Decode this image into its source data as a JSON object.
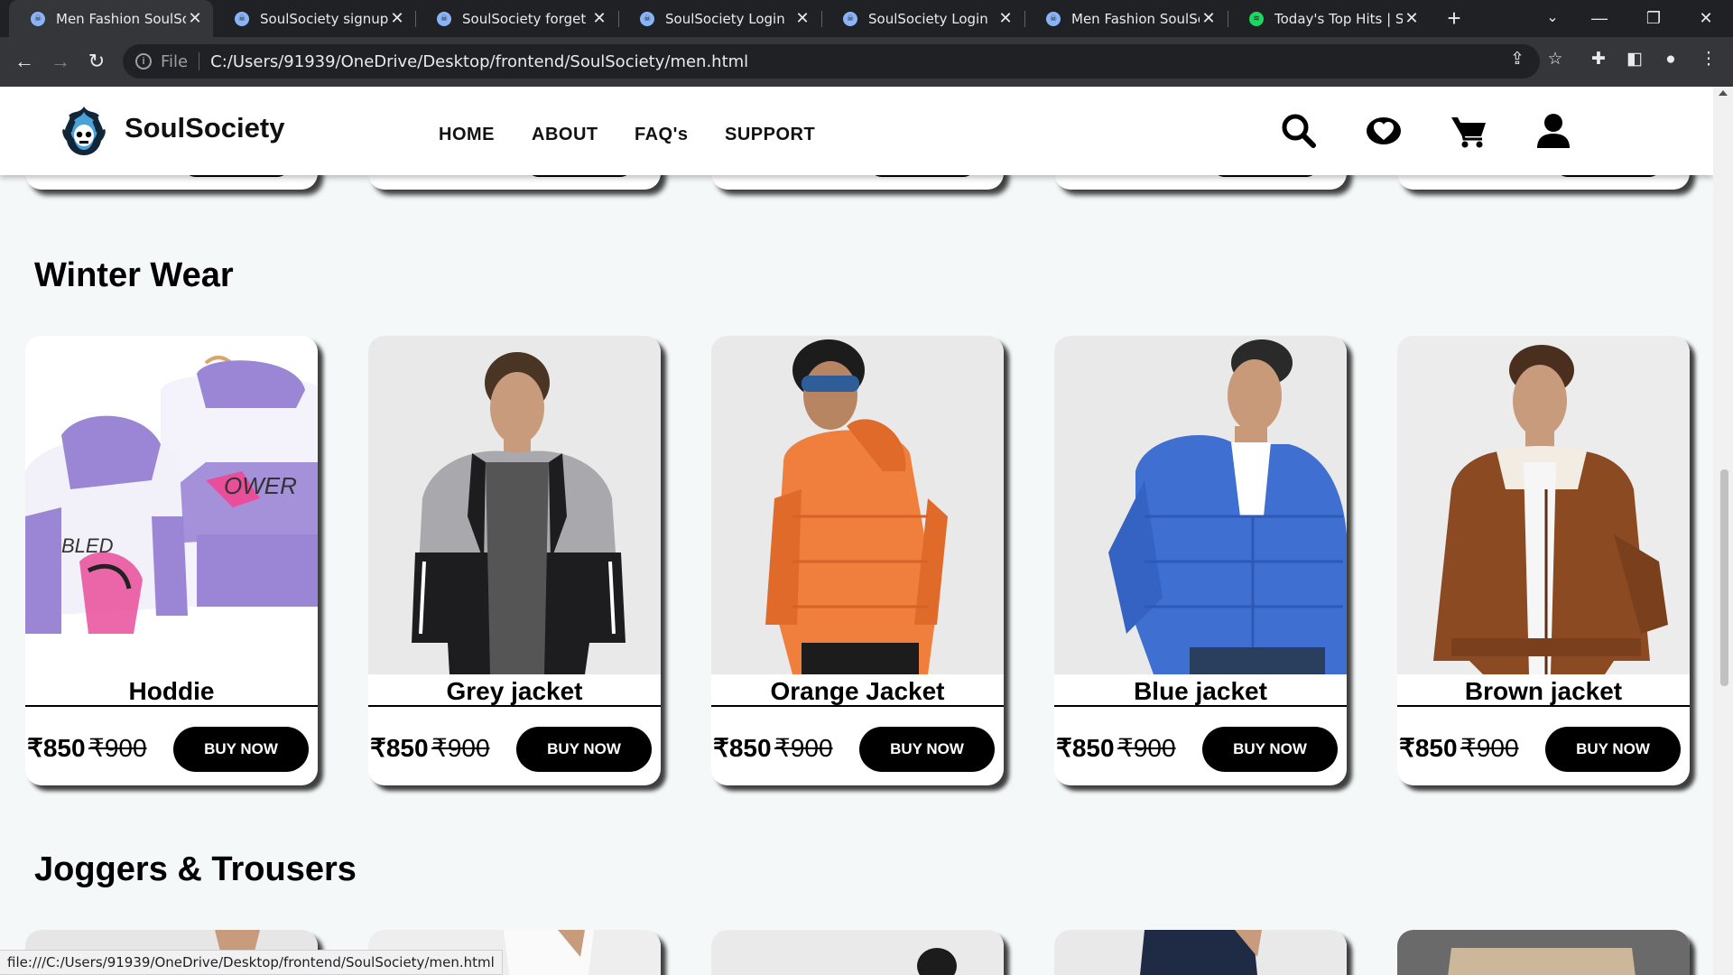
{
  "browser": {
    "tabs": [
      {
        "title": "Men Fashion SoulSoci",
        "active": true,
        "icon": "soulsociety-favicon"
      },
      {
        "title": "SoulSociety signup pa",
        "active": false,
        "icon": "soulsociety-favicon"
      },
      {
        "title": "SoulSociety forget pa",
        "active": false,
        "icon": "soulsociety-favicon"
      },
      {
        "title": "SoulSociety Login",
        "active": false,
        "icon": "soulsociety-favicon"
      },
      {
        "title": "SoulSociety Login",
        "active": false,
        "icon": "soulsociety-favicon"
      },
      {
        "title": "Men Fashion SoulSoc",
        "active": false,
        "icon": "soulsociety-favicon"
      },
      {
        "title": "Today's Top Hits | Spo",
        "active": false,
        "icon": "spotify-favicon"
      }
    ],
    "address": {
      "scheme_label": "File",
      "url": "C:/Users/91939/OneDrive/Desktop/frontend/SoulSociety/men.html"
    },
    "status_url": "file:///C:/Users/91939/OneDrive/Desktop/frontend/SoulSociety/men.html"
  },
  "site": {
    "brand": "SoulSociety",
    "nav": [
      "HOME",
      "ABOUT",
      "FAQ's",
      "SUPPORT"
    ],
    "header_icons": [
      "search-icon",
      "heart-icon",
      "cart-icon",
      "user-icon"
    ]
  },
  "sections": [
    {
      "title": "Winter Wear",
      "products": [
        {
          "name": "Hoddie",
          "price": "₹850",
          "old_price": "₹900",
          "button": "BUY NOW",
          "color": "#9b86d6"
        },
        {
          "name": "Grey jacket",
          "price": "₹850",
          "old_price": "₹900",
          "button": "BUY NOW",
          "color": "#3a3a3a"
        },
        {
          "name": "Orange Jacket",
          "price": "₹850",
          "old_price": "₹900",
          "button": "BUY NOW",
          "color": "#f07e3c"
        },
        {
          "name": "Blue jacket",
          "price": "₹850",
          "old_price": "₹900",
          "button": "BUY NOW",
          "color": "#3f6fd1"
        },
        {
          "name": "Brown jacket",
          "price": "₹850",
          "old_price": "₹900",
          "button": "BUY NOW",
          "color": "#8b4a22"
        }
      ]
    },
    {
      "title": "Joggers & Trousers"
    }
  ]
}
